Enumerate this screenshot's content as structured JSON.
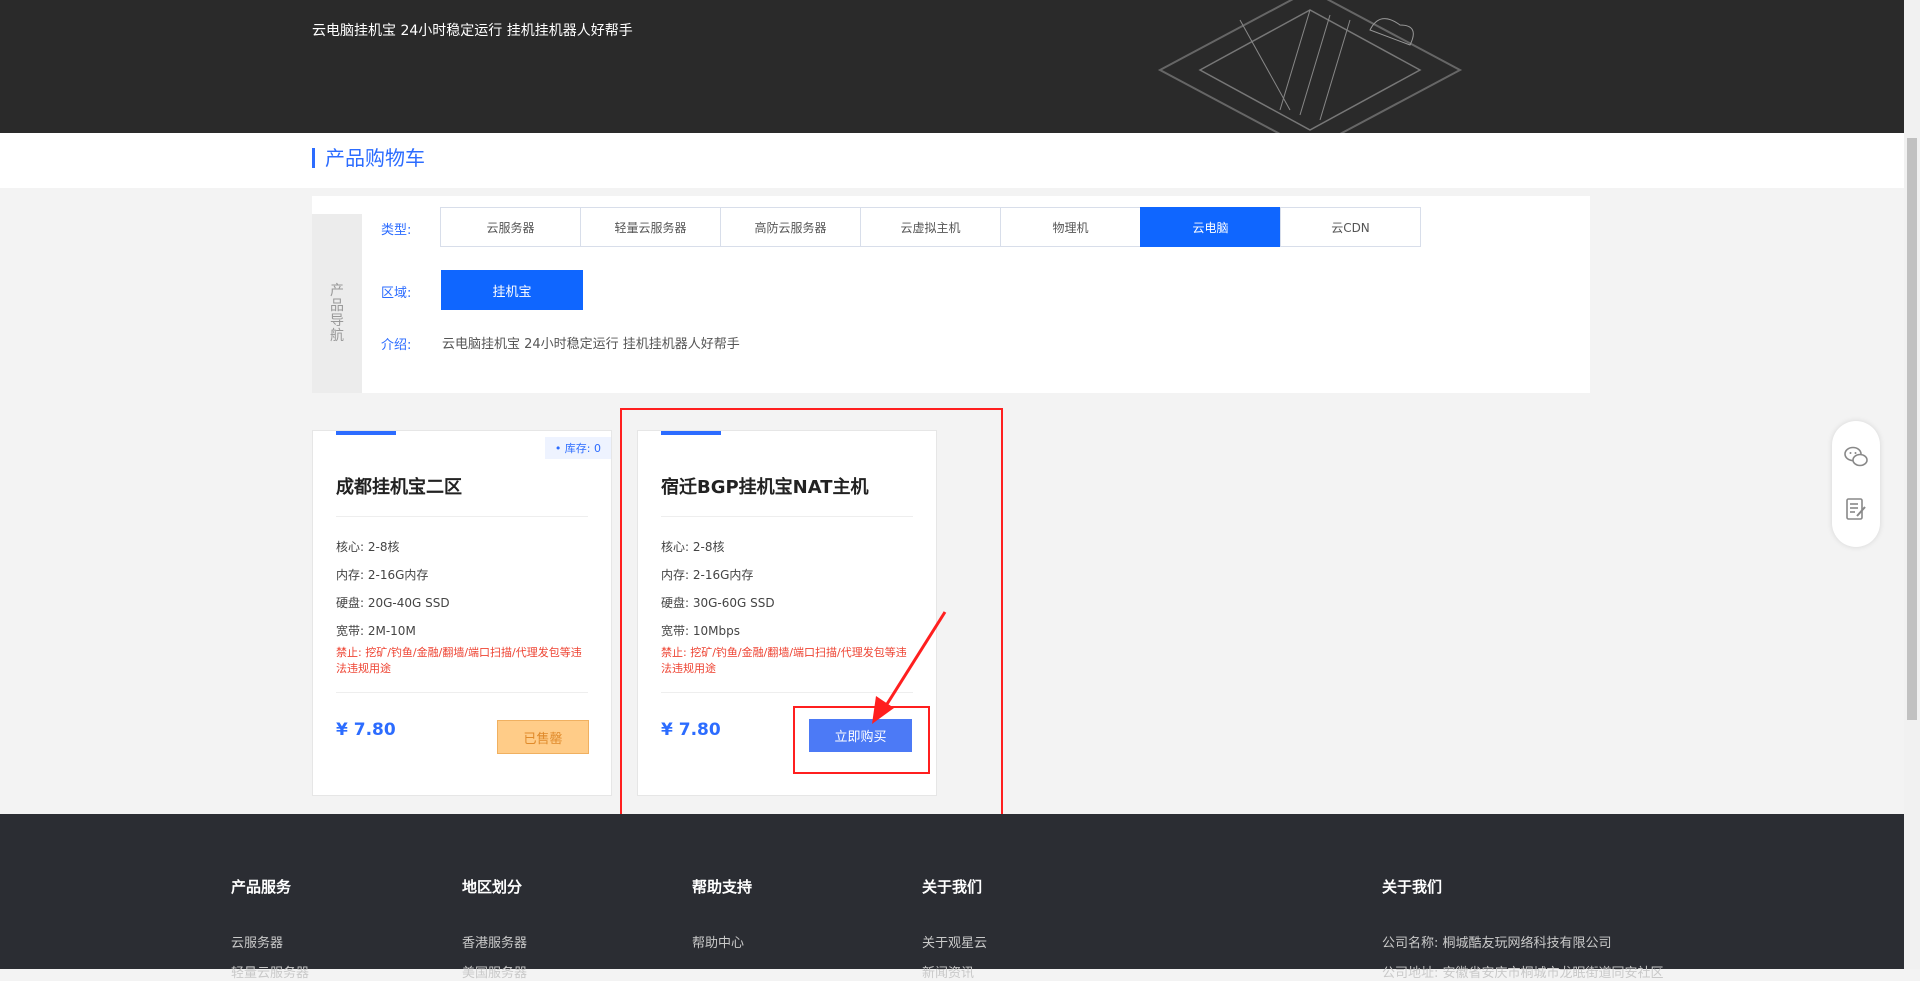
{
  "banner": {
    "text": "云电脑挂机宝 24小时稳定运行 挂机挂机器人好帮手"
  },
  "cart": {
    "title": "产品购物车"
  },
  "nav": {
    "side_label": "产品导航",
    "type_label": "类型:",
    "region_label": "区域:",
    "intro_label": "介绍:",
    "types": [
      "云服务器",
      "轻量云服务器",
      "高防云服务器",
      "云虚拟主机",
      "物理机",
      "云电脑",
      "云CDN"
    ],
    "active_type": "云电脑",
    "region": "挂机宝",
    "intro": "云电脑挂机宝 24小时稳定运行 挂机挂机器人好帮手"
  },
  "products": [
    {
      "name": "成都挂机宝二区",
      "stock": "• 库存:  0",
      "core": "核心: 2-8核",
      "memory": "内存: 2-16G内存",
      "disk": "硬盘: 20G-40G SSD",
      "bandwidth": "宽带: 2M-10M",
      "warning": "禁止: 挖矿/钓鱼/金融/翻墙/端口扫描/代理发包等违法违规用途",
      "price": "¥ 7.80",
      "button": "已售罄"
    },
    {
      "name": "宿迁BGP挂机宝NAT主机",
      "core": "核心: 2-8核",
      "memory": "内存: 2-16G内存",
      "disk": "硬盘: 30G-60G SSD",
      "bandwidth": "宽带: 10Mbps",
      "warning": "禁止: 挖矿/钓鱼/金融/翻墙/端口扫描/代理发包等违法违规用途",
      "price": "¥ 7.80",
      "button": "立即购买"
    }
  ],
  "footer": {
    "columns": [
      {
        "title": "产品服务",
        "link": "云服务器",
        "link2": "轻量云服务器"
      },
      {
        "title": "地区划分",
        "link": "香港服务器",
        "link2": "美国服务器"
      },
      {
        "title": "帮助支持",
        "link": "帮助中心",
        "link2": ""
      },
      {
        "title": "关于我们",
        "link": "关于观星云",
        "link2": "新闻资讯"
      },
      {
        "title": "关于我们",
        "link": "公司名称: 桐城酷友玩网络科技有限公司",
        "link2": "公司地址: 安徽省安庆市桐城市龙眠街道同安社区"
      }
    ]
  },
  "colors": {
    "accent": "#0f66ff",
    "highlight": "#ff1f1f",
    "warning": "#ee4433"
  },
  "icons": [
    "wechat-icon",
    "edit-note-icon"
  ]
}
